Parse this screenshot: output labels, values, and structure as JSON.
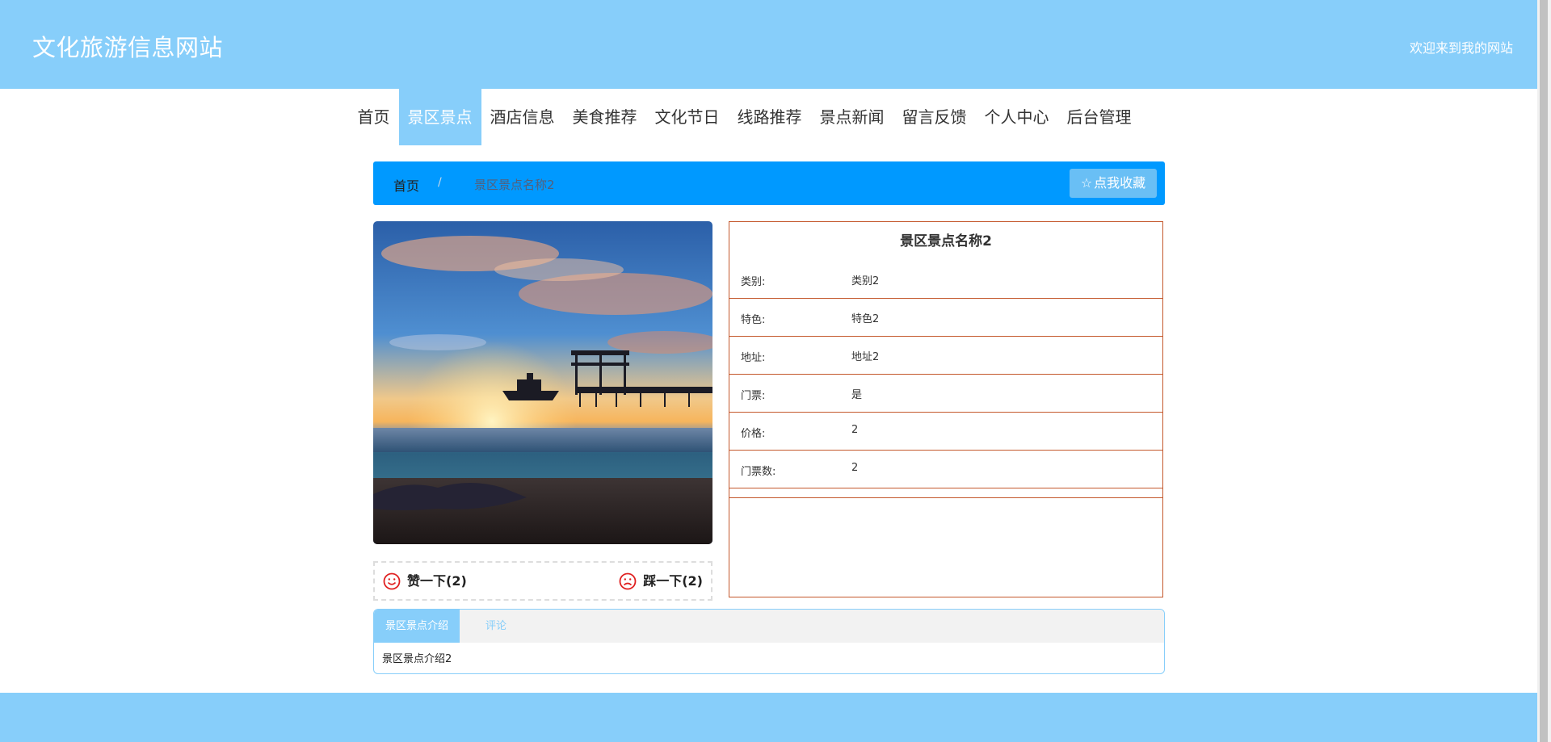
{
  "header": {
    "site_title": "文化旅游信息网站",
    "welcome": "欢迎来到我的网站"
  },
  "nav": {
    "items": [
      {
        "label": "首页"
      },
      {
        "label": "景区景点",
        "active": true
      },
      {
        "label": "酒店信息"
      },
      {
        "label": "美食推荐"
      },
      {
        "label": "文化节日"
      },
      {
        "label": "线路推荐"
      },
      {
        "label": "景点新闻"
      },
      {
        "label": "留言反馈"
      },
      {
        "label": "个人中心"
      },
      {
        "label": "后台管理"
      }
    ]
  },
  "breadcrumb": {
    "home": "首页",
    "separator": "/",
    "current": "景区景点名称2"
  },
  "favorite_button": {
    "icon": "star-outline-icon",
    "label": "点我收藏"
  },
  "votes": {
    "like_label": "赞一下(2)",
    "dislike_label": "踩一下(2)",
    "icon_color": "#e02020"
  },
  "details": {
    "title": "景区景点名称2",
    "rows": [
      {
        "label": "类别:",
        "value": "类别2"
      },
      {
        "label": "特色:",
        "value": "特色2"
      },
      {
        "label": "地址:",
        "value": "地址2"
      },
      {
        "label": "门票:",
        "value": "是"
      },
      {
        "label": "价格:",
        "value": "2"
      },
      {
        "label": "门票数:",
        "value": "2"
      }
    ]
  },
  "tabs": {
    "items": [
      {
        "label": "景区景点介绍",
        "active": true
      },
      {
        "label": "评论"
      }
    ],
    "content": "景区景点介绍2"
  },
  "colors": {
    "header_bg": "#87cefa",
    "breadcrumb_bg": "#0099ff",
    "detail_border": "#c4582c"
  }
}
